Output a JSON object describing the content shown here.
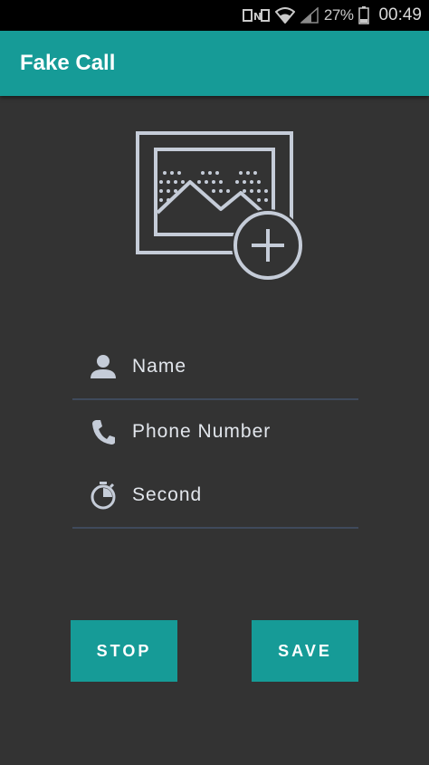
{
  "status_bar": {
    "battery_percent": "27%",
    "time": "00:49",
    "icons": [
      "nfc-icon",
      "wifi-icon",
      "signal-icon",
      "battery-icon"
    ]
  },
  "app_bar": {
    "title": "Fake Call",
    "color": "#169b97"
  },
  "photo_picker": {
    "icon": "add-photo-icon"
  },
  "form": {
    "fields": [
      {
        "icon": "person-icon",
        "label": "Name"
      },
      {
        "icon": "phone-icon",
        "label": "Phone Number"
      },
      {
        "icon": "timer-icon",
        "label": "Second"
      }
    ]
  },
  "buttons": {
    "stop_label": "STOP",
    "save_label": "SAVE"
  }
}
